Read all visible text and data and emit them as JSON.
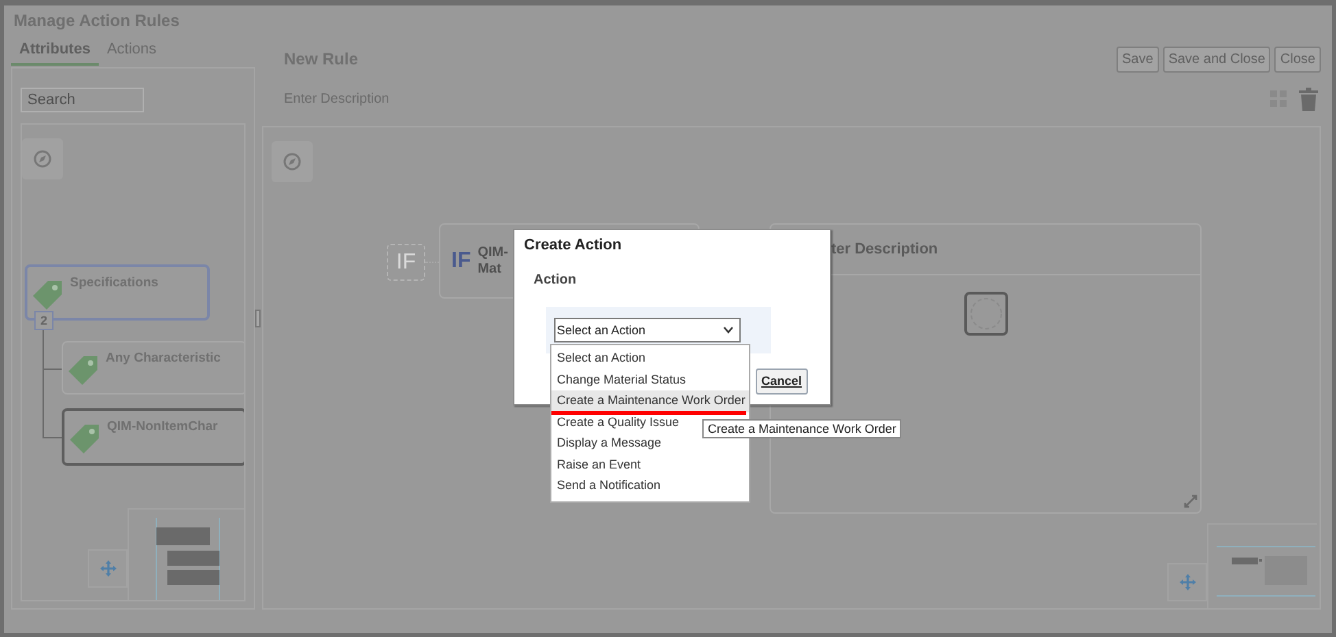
{
  "window": {
    "title": "Manage Action Rules"
  },
  "tabs": [
    {
      "label": "Attributes",
      "selected": true
    },
    {
      "label": "Actions",
      "selected": false
    }
  ],
  "search": {
    "placeholder": "Search"
  },
  "attribute_tree": {
    "label": "Specifications",
    "badge": "2",
    "children": [
      {
        "label": "Any Characteristic",
        "selected": false
      },
      {
        "label": "QIM-NonItemChar",
        "selected": true
      }
    ]
  },
  "rule": {
    "title": "New Rule",
    "description": "Enter Description"
  },
  "buttons": [
    {
      "label": "Save"
    },
    {
      "label": "Save and Close"
    },
    {
      "label": "Close"
    }
  ],
  "canvas": {
    "if_placeholder": "IF",
    "if_node": {
      "keyword": "IF",
      "lines": [
        "QIM-",
        "Mat"
      ]
    },
    "action_node": {
      "title": "ter Description"
    }
  },
  "dialog": {
    "title": "Create Action",
    "field_label": "Action",
    "select_value": "Select an Action",
    "buttons": [
      {
        "label": "Cancel"
      }
    ]
  },
  "dropdown": {
    "options": [
      {
        "label": "Select an Action",
        "hovered": false,
        "underlined": false
      },
      {
        "label": "Change Material Status",
        "hovered": false,
        "underlined": false
      },
      {
        "label": "Create a Maintenance Work Order",
        "hovered": true,
        "underlined": true
      },
      {
        "label": "Create a Quality Issue",
        "hovered": false,
        "underlined": false
      },
      {
        "label": "Display a Message",
        "hovered": false,
        "underlined": false
      },
      {
        "label": "Raise an Event",
        "hovered": false,
        "underlined": false
      },
      {
        "label": "Send a Notification",
        "hovered": false,
        "underlined": false
      }
    ]
  },
  "tooltip": {
    "text": "Create a Maintenance Work Order"
  }
}
